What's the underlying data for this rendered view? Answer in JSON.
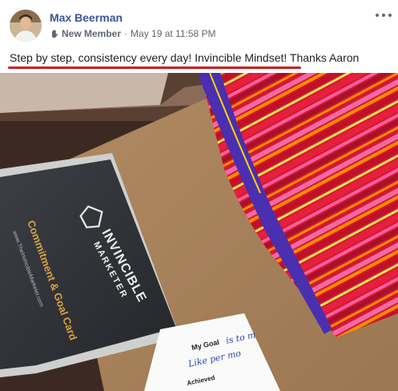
{
  "post": {
    "author": "Max Beerman",
    "badge": "New Member",
    "separator": "·",
    "timestamp": "May 19 at 11:58 PM",
    "text": "Step by step, consistency every day! Invincible Mindset! Thanks Aaron"
  },
  "photo": {
    "card_brand": "INVINCIBLE",
    "card_brand_sub": "MARKETER",
    "card_title": "Commitment & Goal Card",
    "card_url": "www.TheInvincibleMarketer.com",
    "goal_label": "My Goal",
    "goal_handwriting_1": "is to m",
    "goal_handwriting_2": "Like per mo",
    "achieved_label": "Achieved"
  },
  "colors": {
    "link": "#385898",
    "meta": "#606770",
    "annotation": "#d61a1a"
  },
  "icons": {
    "badge": "new-member-hand-icon",
    "more": "more-options-icon"
  }
}
